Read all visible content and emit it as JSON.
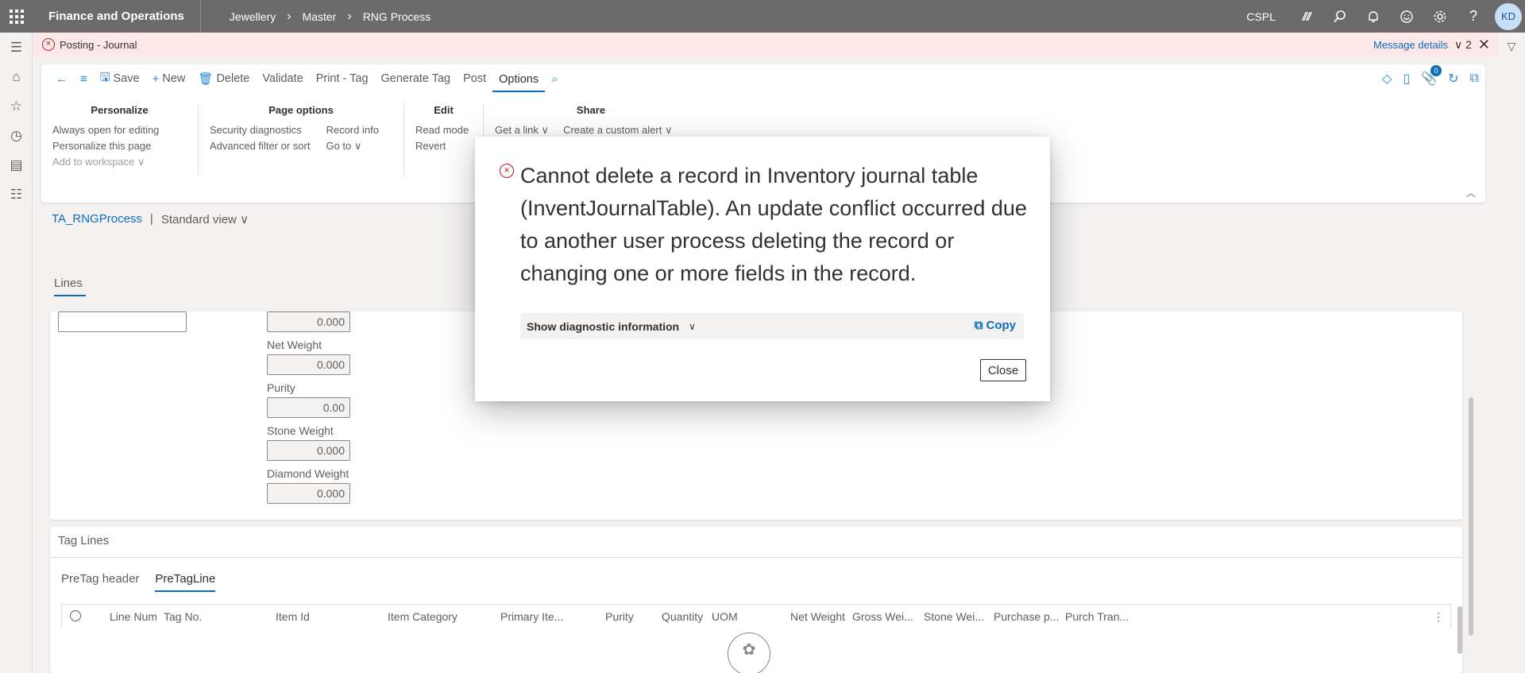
{
  "topbar": {
    "app_title": "Finance and Operations",
    "breadcrumb": [
      "Jewellery",
      "Master",
      "RNG Process"
    ],
    "company": "CSPL",
    "avatar_initials": "KD"
  },
  "message_bar": {
    "text": "Posting - Journal",
    "details_link": "Message details",
    "count": "2"
  },
  "action_pane": {
    "buttons": {
      "save": "Save",
      "new": "New",
      "delete": "Delete",
      "validate": "Validate",
      "print_tag": "Print - Tag",
      "generate_tag": "Generate Tag",
      "post": "Post",
      "options": "Options"
    },
    "attachments_count": "0",
    "groups": {
      "personalize": {
        "title": "Personalize",
        "items": [
          "Always open for editing",
          "Personalize this page",
          "Add to workspace"
        ]
      },
      "page_options": {
        "title": "Page options",
        "col1": [
          "Security diagnostics",
          "Advanced filter or sort"
        ],
        "col2": [
          "Record info",
          "Go to"
        ]
      },
      "edit": {
        "title": "Edit",
        "items": [
          "Read mode",
          "Revert"
        ]
      },
      "share": {
        "title": "Share",
        "items": [
          "Get a link",
          "Create a custom alert"
        ]
      }
    }
  },
  "view": {
    "name": "TA_RNGProcess",
    "separator": "|",
    "selector": "Standard view"
  },
  "lines_tab": "Lines",
  "details": {
    "first_value": "0.000",
    "fields": [
      {
        "label": "Net Weight",
        "value": "0.000"
      },
      {
        "label": "Purity",
        "value": "0.00"
      },
      {
        "label": "Stone Weight",
        "value": "0.000"
      },
      {
        "label": "Diamond Weight",
        "value": "0.000"
      }
    ]
  },
  "tag_lines": {
    "title": "Tag Lines",
    "tabs": [
      "PreTag header",
      "PreTagLine"
    ],
    "columns": [
      "Line Num",
      "Tag No.",
      "Item Id",
      "Item Category",
      "Primary Ite...",
      "Purity",
      "Quantity",
      "UOM",
      "Net Weight",
      "Gross Wei...",
      "Stone Wei...",
      "Purchase p...",
      "Purch Tran..."
    ]
  },
  "dialog": {
    "message": "Cannot delete a record in Inventory journal table (InventJournalTable). An update conflict occurred due to another user process deleting the record or changing one or more fields in the record.",
    "diagnostic_label": "Show diagnostic information",
    "copy_label": "Copy",
    "close_label": "Close"
  }
}
